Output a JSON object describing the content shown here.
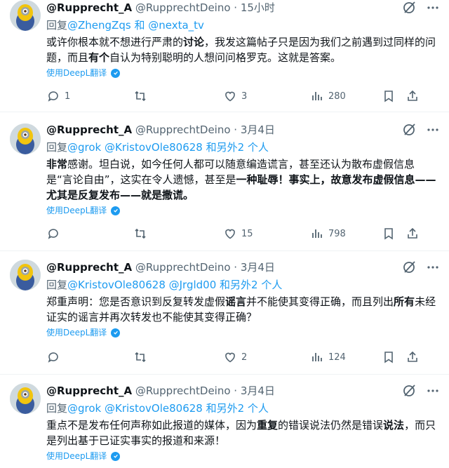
{
  "tweets": [
    {
      "name": "@Rupprecht_A",
      "handle": "@RupprechtDeino · 15小时",
      "reply_prefix": "回复",
      "reply_mentions": "@ZhengZqs",
      "reply_and": " 和 ",
      "reply_mentions2": "@nexta_tv",
      "text_parts": [
        "或许你根本就不想进行严肃的",
        "讨论",
        "，我发这篇帖子只是因为我们之前遇到过同样的问题，而且",
        "有个",
        "自认为特别聪明的人想问问格罗克。这就是答案。"
      ],
      "deepl": "使用DeepL翻译",
      "replies": "1",
      "retweets": "",
      "likes": "3",
      "views": "280"
    },
    {
      "name": "@Rupprecht_A",
      "handle": "@RupprechtDeino · 3月4日",
      "reply_prefix": "回复",
      "reply_mentions": "@grok @KristovOle80628 和另外2 个人",
      "text_parts": [
        "非常",
        "感谢。坦白说，如今任何人都可以随意编造谎言，甚至还认为散布虚假信息是“言论自由”，这实在令人遗憾，甚至是",
        "一种耻辱！事实上，故意发布虚假信息——尤其是反复发布——就是撒谎。"
      ],
      "deepl": "使用DeepL翻译",
      "replies": "",
      "retweets": "",
      "likes": "15",
      "views": "798"
    },
    {
      "name": "@Rupprecht_A",
      "handle": "@RupprechtDeino · 3月4日",
      "reply_prefix": "回复",
      "reply_mentions": "@KristovOle80628 @Jrgld00 和另外2 个人",
      "text_parts": [
        "郑重声明：您是否意识到反复转发虚假",
        "谣言",
        "并不能使其变得正确，而且列出",
        "所有",
        "未经证实的谣言并再次转发也不能使其变得正确？"
      ],
      "deepl": "使用DeepL翻译",
      "replies": "",
      "retweets": "",
      "likes": "2",
      "views": "124"
    },
    {
      "name": "@Rupprecht_A",
      "handle": "@RupprechtDeino · 3月4日",
      "reply_prefix": "回复",
      "reply_mentions": "@grok @KristovOle80628 和另外2 个人",
      "text_parts": [
        "重点不是发布任何声称如此报道的媒体，因为",
        "重复",
        "的错误说法仍然是错误",
        "说法",
        "，而只是列出基于已证实事实的报道和来源！"
      ],
      "deepl": "使用DeepL翻译",
      "replies": "",
      "retweets": "",
      "likes": "",
      "views": ""
    }
  ],
  "colors": {
    "accent": "#1d9bf0",
    "muted": "#536471",
    "text": "#0f1419"
  }
}
